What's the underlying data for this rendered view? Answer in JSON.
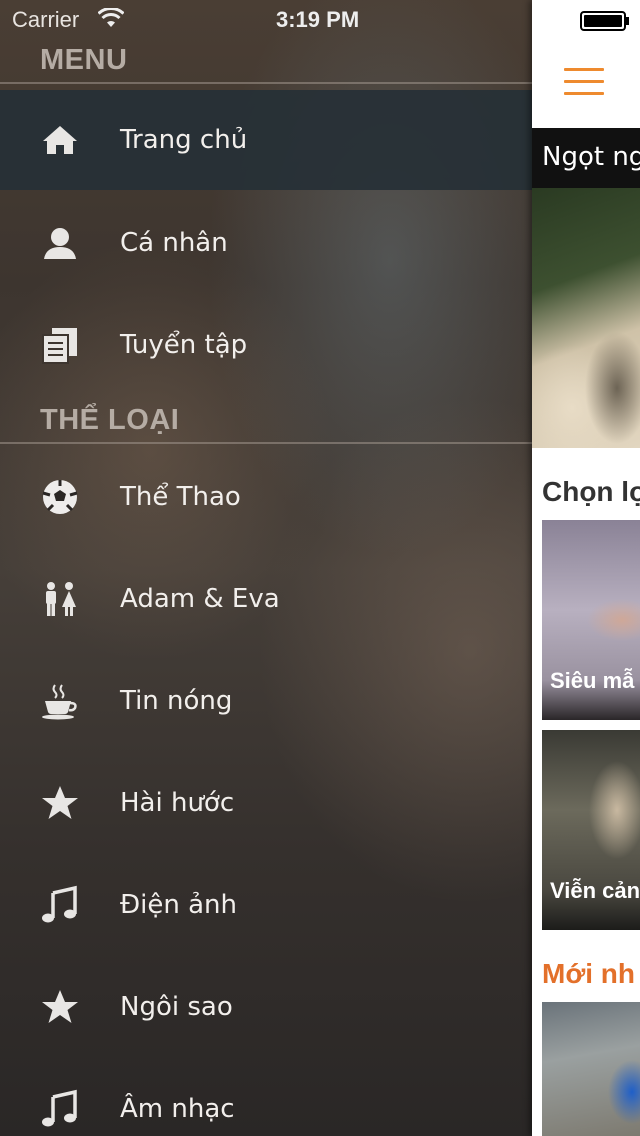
{
  "status_bar": {
    "carrier": "Carrier",
    "time": "3:19 PM"
  },
  "menu": {
    "header_menu": "MENU",
    "header_categories": "THỂ LOẠI",
    "main_items": [
      {
        "label": "Trang chủ",
        "icon": "home-icon",
        "active": true
      },
      {
        "label": "Cá nhân",
        "icon": "user-icon",
        "active": false
      },
      {
        "label": "Tuyển tập",
        "icon": "collection-icon",
        "active": false
      }
    ],
    "category_items": [
      {
        "label": "Thể Thao",
        "icon": "soccer-ball-icon"
      },
      {
        "label": "Adam & Eva",
        "icon": "couple-icon"
      },
      {
        "label": "Tin nóng",
        "icon": "coffee-cup-icon"
      },
      {
        "label": "Hài hước",
        "icon": "star-icon"
      },
      {
        "label": "Điện ảnh",
        "icon": "music-note-icon"
      },
      {
        "label": "Ngôi sao",
        "icon": "star-icon"
      },
      {
        "label": "Âm nhạc",
        "icon": "music-note-icon"
      }
    ]
  },
  "content": {
    "hero_title": "Ngọt ng",
    "section_picked": "Chọn lọ",
    "card_1_caption": "Siêu mẫ",
    "card_2_caption": "Viễn cản",
    "section_new": "Mới nh"
  },
  "colors": {
    "accent": "#ee8a2e",
    "new_section": "#e3702a",
    "active_row": "#263036"
  }
}
